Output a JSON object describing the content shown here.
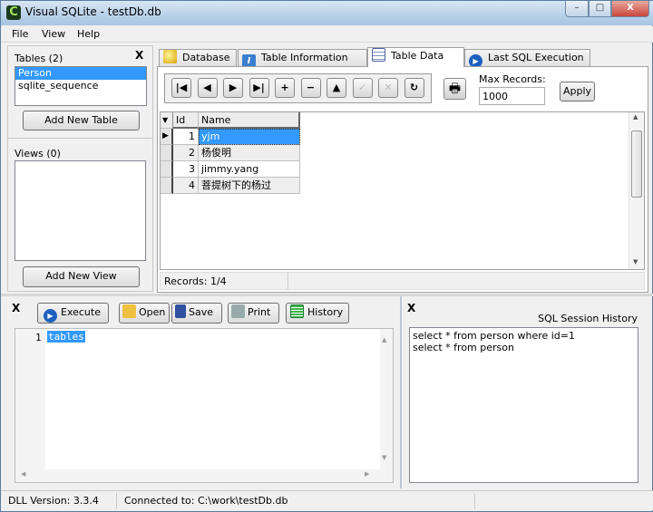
{
  "window": {
    "title": "Visual SQLite - testDb.db",
    "controls": {
      "minimize": "–",
      "maximize": "□",
      "close": "X"
    }
  },
  "menu": [
    "File",
    "View",
    "Help"
  ],
  "tables": {
    "label": "Tables (2)",
    "items": [
      "Person",
      "sqlite_sequence"
    ],
    "selected": "Person",
    "add_button": "Add New Table",
    "close": "X"
  },
  "views": {
    "label": "Views (0)",
    "items": [],
    "add_button": "Add New View"
  },
  "tabs": [
    {
      "label": "Database",
      "icon": "magnifier-icon"
    },
    {
      "label": "Table Information",
      "icon": "info-icon"
    },
    {
      "label": "Table Data",
      "icon": "grid-icon",
      "active": true
    },
    {
      "label": "Last SQL Execution",
      "icon": "play-icon"
    }
  ],
  "navigator": {
    "buttons": [
      {
        "name": "first",
        "glyph": "|◀"
      },
      {
        "name": "prior",
        "glyph": "◀"
      },
      {
        "name": "next",
        "glyph": "▶"
      },
      {
        "name": "last",
        "glyph": "▶|"
      },
      {
        "name": "insert",
        "glyph": "+"
      },
      {
        "name": "delete",
        "glyph": "−"
      },
      {
        "name": "edit",
        "glyph": "▲"
      },
      {
        "name": "post",
        "glyph": "✓"
      },
      {
        "name": "cancel",
        "glyph": "✕"
      },
      {
        "name": "refresh",
        "glyph": "↻"
      }
    ]
  },
  "max_records": {
    "label": "Max Records:",
    "value": "1000",
    "apply": "Apply"
  },
  "grid": {
    "columns": [
      "Id",
      "Name"
    ],
    "rows": [
      {
        "id": "1",
        "name": "yjm"
      },
      {
        "id": "2",
        "name": "杨俊明"
      },
      {
        "id": "3",
        "name": "jimmy.yang"
      },
      {
        "id": "4",
        "name": "菩提树下的杨过"
      }
    ],
    "selected_row": 0,
    "records": "Records: 1/4"
  },
  "sql": {
    "close": "X",
    "buttons": {
      "execute": "Execute",
      "open": "Open",
      "save": "Save",
      "print": "Print",
      "history": "History"
    },
    "line_number": "1",
    "text": "tables"
  },
  "history": {
    "close": "X",
    "label": "SQL Session History",
    "items": [
      "select * from person where id=1",
      "select * from person"
    ]
  },
  "status": {
    "dll": "DLL Version: 3.3.4",
    "connected": "Connected to: C:\\work\\testDb.db"
  },
  "colors": {
    "selection": "#3399ff",
    "title_bar": "#b9d1ea",
    "close_button": "#c9463d"
  }
}
